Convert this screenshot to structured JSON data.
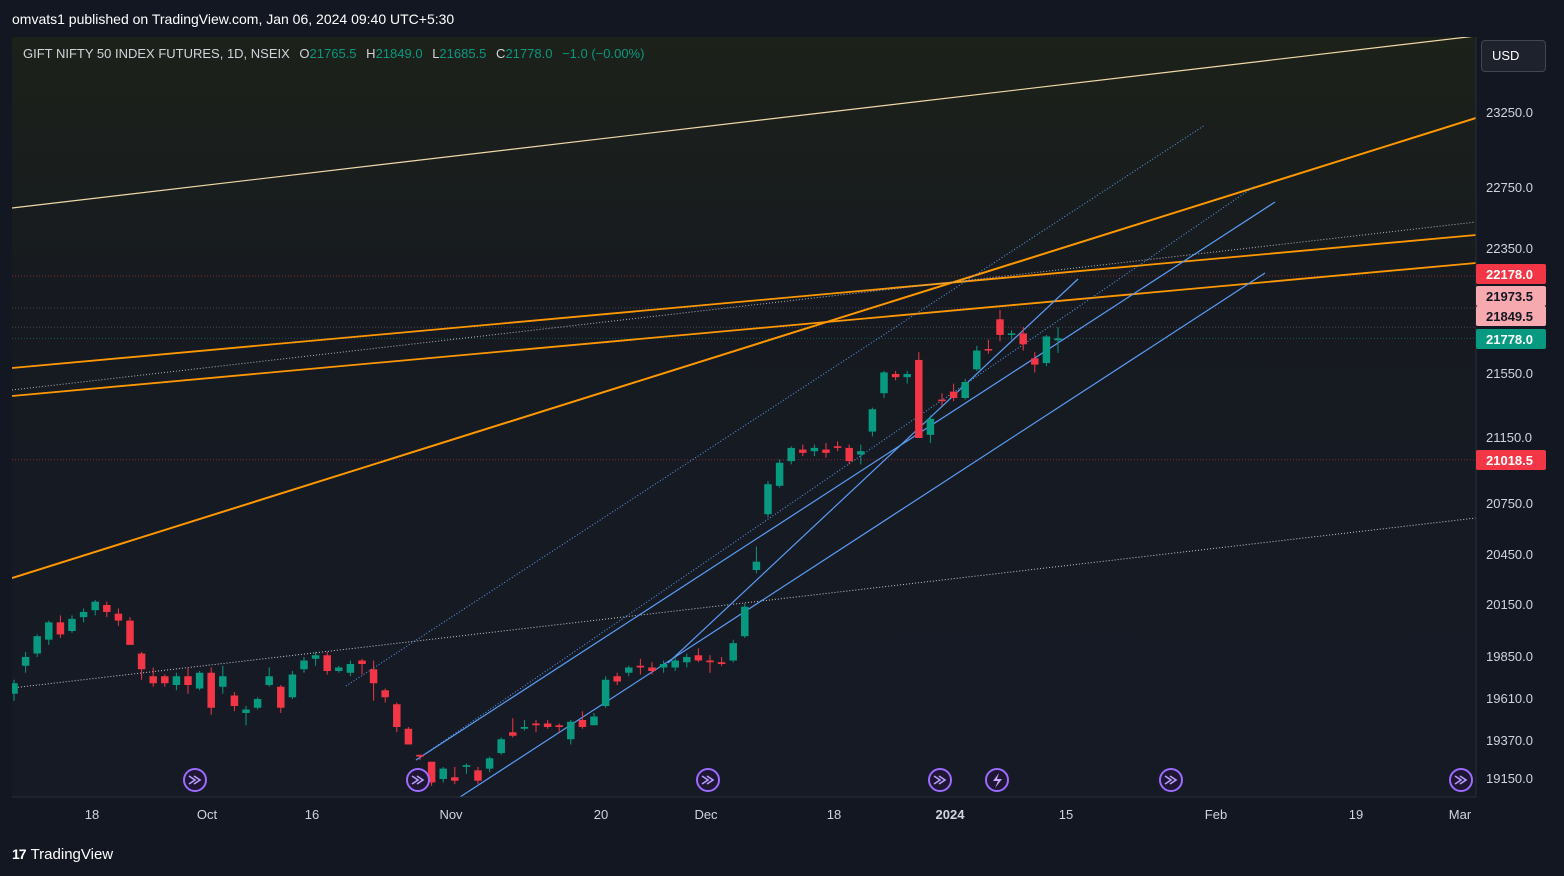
{
  "header": {
    "publisher": "omvats1 published on TradingView.com, Jan 06, 2024 09:40 UTC+5:30"
  },
  "legend": {
    "symbol": "GIFT NIFTY 50 INDEX FUTURES, 1D, NSEIX",
    "open_label": "O",
    "open": "21765.5",
    "high_label": "H",
    "high": "21849.0",
    "low_label": "L",
    "low": "21685.5",
    "close_label": "C",
    "close": "21778.0",
    "change": "−1.0 (−0.00%)"
  },
  "currency_button": "USD",
  "footer": {
    "logo_mark": "17",
    "logo_text": "TradingView"
  },
  "colors": {
    "background": "#131722",
    "up": "#089981",
    "down": "#f23645",
    "trendline_orange": "#ff9800",
    "channel_blue": "#5b9cf6",
    "price_line_green": "#089981"
  },
  "chart_data": {
    "type": "candlestick",
    "symbol": "GIFT NIFTY 50 INDEX FUTURES",
    "interval": "1D",
    "exchange": "NSEIX",
    "y_axis_ticks": [
      23250,
      22750,
      22350,
      21550,
      21150,
      20750,
      20450,
      20150,
      19850,
      19610,
      19370,
      19150
    ],
    "x_axis_ticks": [
      "18",
      "Oct",
      "16",
      "Nov",
      "20",
      "Dec",
      "18",
      "2024",
      "15",
      "Feb",
      "19",
      "Mar"
    ],
    "price_labels": [
      {
        "value": "22178.0",
        "color": "#f23645"
      },
      {
        "value": "21973.5",
        "color": "#f7a9b0"
      },
      {
        "value": "21849.5",
        "color": "#f7a9b0"
      },
      {
        "value": "21778.0",
        "color": "#089981"
      },
      {
        "value": "21018.5",
        "color": "#f23645"
      }
    ],
    "last_price": 21778.0,
    "candles": [
      {
        "o": 19640,
        "h": 19720,
        "l": 19600,
        "c": 19700
      },
      {
        "o": 19800,
        "h": 19880,
        "l": 19760,
        "c": 19850
      },
      {
        "o": 19870,
        "h": 19980,
        "l": 19850,
        "c": 19970
      },
      {
        "o": 19950,
        "h": 20060,
        "l": 19920,
        "c": 20050
      },
      {
        "o": 20050,
        "h": 20090,
        "l": 19960,
        "c": 19980
      },
      {
        "o": 20000,
        "h": 20090,
        "l": 19990,
        "c": 20070
      },
      {
        "o": 20080,
        "h": 20130,
        "l": 20050,
        "c": 20110
      },
      {
        "o": 20120,
        "h": 20180,
        "l": 20090,
        "c": 20170
      },
      {
        "o": 20150,
        "h": 20170,
        "l": 20080,
        "c": 20110
      },
      {
        "o": 20100,
        "h": 20130,
        "l": 20030,
        "c": 20060
      },
      {
        "o": 20060,
        "h": 20080,
        "l": 19950,
        "c": 19920
      },
      {
        "o": 19870,
        "h": 19880,
        "l": 19720,
        "c": 19780
      },
      {
        "o": 19740,
        "h": 19790,
        "l": 19680,
        "c": 19700
      },
      {
        "o": 19740,
        "h": 19750,
        "l": 19680,
        "c": 19700
      },
      {
        "o": 19690,
        "h": 19760,
        "l": 19660,
        "c": 19740
      },
      {
        "o": 19740,
        "h": 19790,
        "l": 19640,
        "c": 19690
      },
      {
        "o": 19670,
        "h": 19770,
        "l": 19660,
        "c": 19760
      },
      {
        "o": 19760,
        "h": 19790,
        "l": 19520,
        "c": 19560
      },
      {
        "o": 19680,
        "h": 19800,
        "l": 19640,
        "c": 19740
      },
      {
        "o": 19630,
        "h": 19650,
        "l": 19540,
        "c": 19570
      },
      {
        "o": 19530,
        "h": 19570,
        "l": 19460,
        "c": 19550
      },
      {
        "o": 19560,
        "h": 19620,
        "l": 19550,
        "c": 19610
      },
      {
        "o": 19690,
        "h": 19790,
        "l": 19680,
        "c": 19740
      },
      {
        "o": 19680,
        "h": 19690,
        "l": 19530,
        "c": 19560
      },
      {
        "o": 19620,
        "h": 19770,
        "l": 19610,
        "c": 19750
      },
      {
        "o": 19780,
        "h": 19850,
        "l": 19760,
        "c": 19830
      },
      {
        "o": 19840,
        "h": 19880,
        "l": 19800,
        "c": 19860
      },
      {
        "o": 19860,
        "h": 19880,
        "l": 19750,
        "c": 19770
      },
      {
        "o": 19770,
        "h": 19800,
        "l": 19760,
        "c": 19790
      },
      {
        "o": 19760,
        "h": 19830,
        "l": 19740,
        "c": 19810
      },
      {
        "o": 19830,
        "h": 19840,
        "l": 19750,
        "c": 19810
      },
      {
        "o": 19780,
        "h": 19830,
        "l": 19600,
        "c": 19700
      },
      {
        "o": 19660,
        "h": 19670,
        "l": 19590,
        "c": 19620
      },
      {
        "o": 19580,
        "h": 19590,
        "l": 19420,
        "c": 19450
      },
      {
        "o": 19440,
        "h": 19450,
        "l": 19360,
        "c": 19350
      },
      {
        "o": 19290,
        "h": 19290,
        "l": 19260,
        "c": 19280
      },
      {
        "o": 19250,
        "h": 19250,
        "l": 19110,
        "c": 19130
      },
      {
        "o": 19150,
        "h": 19220,
        "l": 19130,
        "c": 19210
      },
      {
        "o": 19160,
        "h": 19220,
        "l": 19120,
        "c": 19140
      },
      {
        "o": 19220,
        "h": 19240,
        "l": 19180,
        "c": 19230
      },
      {
        "o": 19200,
        "h": 19220,
        "l": 19120,
        "c": 19140
      },
      {
        "o": 19210,
        "h": 19280,
        "l": 19190,
        "c": 19270
      },
      {
        "o": 19300,
        "h": 19390,
        "l": 19290,
        "c": 19380
      },
      {
        "o": 19420,
        "h": 19500,
        "l": 19390,
        "c": 19400
      },
      {
        "o": 19440,
        "h": 19490,
        "l": 19430,
        "c": 19450
      },
      {
        "o": 19470,
        "h": 19490,
        "l": 19420,
        "c": 19460
      },
      {
        "o": 19470,
        "h": 19490,
        "l": 19440,
        "c": 19450
      },
      {
        "o": 19460,
        "h": 19470,
        "l": 19420,
        "c": 19450
      },
      {
        "o": 19380,
        "h": 19490,
        "l": 19350,
        "c": 19480
      },
      {
        "o": 19490,
        "h": 19540,
        "l": 19440,
        "c": 19450
      },
      {
        "o": 19460,
        "h": 19530,
        "l": 19460,
        "c": 19510
      },
      {
        "o": 19570,
        "h": 19740,
        "l": 19560,
        "c": 19720
      },
      {
        "o": 19740,
        "h": 19760,
        "l": 19690,
        "c": 19710
      },
      {
        "o": 19760,
        "h": 19800,
        "l": 19740,
        "c": 19790
      },
      {
        "o": 19800,
        "h": 19840,
        "l": 19750,
        "c": 19790
      },
      {
        "o": 19790,
        "h": 19820,
        "l": 19750,
        "c": 19770
      },
      {
        "o": 19790,
        "h": 19830,
        "l": 19760,
        "c": 19810
      },
      {
        "o": 19790,
        "h": 19850,
        "l": 19770,
        "c": 19830
      },
      {
        "o": 19820,
        "h": 19870,
        "l": 19790,
        "c": 19850
      },
      {
        "o": 19860,
        "h": 19900,
        "l": 19820,
        "c": 19830
      },
      {
        "o": 19830,
        "h": 19860,
        "l": 19760,
        "c": 19820
      },
      {
        "o": 19820,
        "h": 19850,
        "l": 19800,
        "c": 19810
      },
      {
        "o": 19830,
        "h": 19950,
        "l": 19820,
        "c": 19930
      },
      {
        "o": 19970,
        "h": 20160,
        "l": 19960,
        "c": 20140
      },
      {
        "o": 20360,
        "h": 20500,
        "l": 20340,
        "c": 20410
      },
      {
        "o": 20690,
        "h": 20890,
        "l": 20670,
        "c": 20870
      },
      {
        "o": 20860,
        "h": 21020,
        "l": 20850,
        "c": 21000
      },
      {
        "o": 21010,
        "h": 21100,
        "l": 20990,
        "c": 21090
      },
      {
        "o": 21080,
        "h": 21110,
        "l": 21040,
        "c": 21060
      },
      {
        "o": 21070,
        "h": 21110,
        "l": 21040,
        "c": 21090
      },
      {
        "o": 21080,
        "h": 21120,
        "l": 21030,
        "c": 21060
      },
      {
        "o": 21100,
        "h": 21130,
        "l": 21070,
        "c": 21090
      },
      {
        "o": 21090,
        "h": 21110,
        "l": 20990,
        "c": 21010
      },
      {
        "o": 21050,
        "h": 21110,
        "l": 20990,
        "c": 21070
      },
      {
        "o": 21190,
        "h": 21340,
        "l": 21160,
        "c": 21330
      },
      {
        "o": 21430,
        "h": 21570,
        "l": 21400,
        "c": 21560
      },
      {
        "o": 21550,
        "h": 21570,
        "l": 21510,
        "c": 21530
      },
      {
        "o": 21530,
        "h": 21570,
        "l": 21490,
        "c": 21550
      },
      {
        "o": 21640,
        "h": 21690,
        "l": 21190,
        "c": 21150
      },
      {
        "o": 21170,
        "h": 21290,
        "l": 21120,
        "c": 21270
      },
      {
        "o": 21390,
        "h": 21430,
        "l": 21350,
        "c": 21380
      },
      {
        "o": 21440,
        "h": 21490,
        "l": 21380,
        "c": 21400
      },
      {
        "o": 21400,
        "h": 21520,
        "l": 21390,
        "c": 21500
      },
      {
        "o": 21580,
        "h": 21730,
        "l": 21570,
        "c": 21700
      },
      {
        "o": 21710,
        "h": 21770,
        "l": 21680,
        "c": 21700
      },
      {
        "o": 21900,
        "h": 21960,
        "l": 21760,
        "c": 21800
      },
      {
        "o": 21800,
        "h": 21830,
        "l": 21770,
        "c": 21810
      },
      {
        "o": 21810,
        "h": 21850,
        "l": 21700,
        "c": 21740
      },
      {
        "o": 21650,
        "h": 21690,
        "l": 21560,
        "c": 21610
      },
      {
        "o": 21620,
        "h": 21800,
        "l": 21600,
        "c": 21790
      },
      {
        "o": 21765.5,
        "h": 21849,
        "l": 21685.5,
        "c": 21778
      }
    ]
  }
}
